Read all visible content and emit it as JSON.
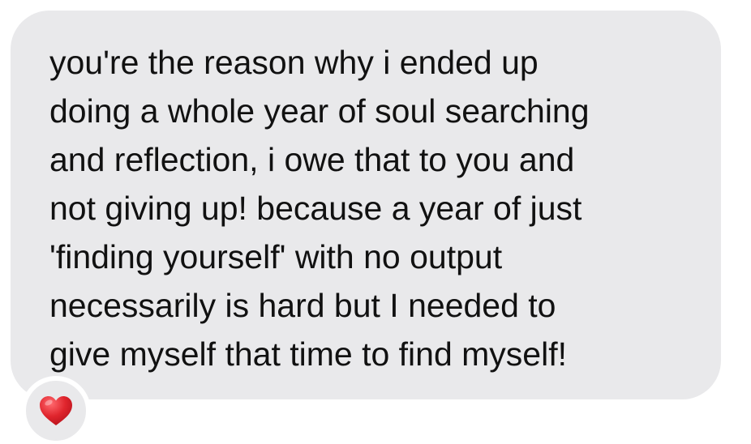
{
  "message": {
    "lines": [
      "you're the reason why i ended up",
      "doing a whole year of soul searching",
      "and reflection, i owe that to you and",
      "not giving up! because a year of just",
      "'finding yourself' with no output",
      "necessarily is hard but I needed to",
      "give myself that time to find myself!"
    ]
  },
  "reaction": {
    "icon": "heart-icon",
    "color": "#e0252d"
  },
  "colors": {
    "bubble": "#e9e9eb",
    "text": "#111111",
    "background": "#ffffff"
  }
}
